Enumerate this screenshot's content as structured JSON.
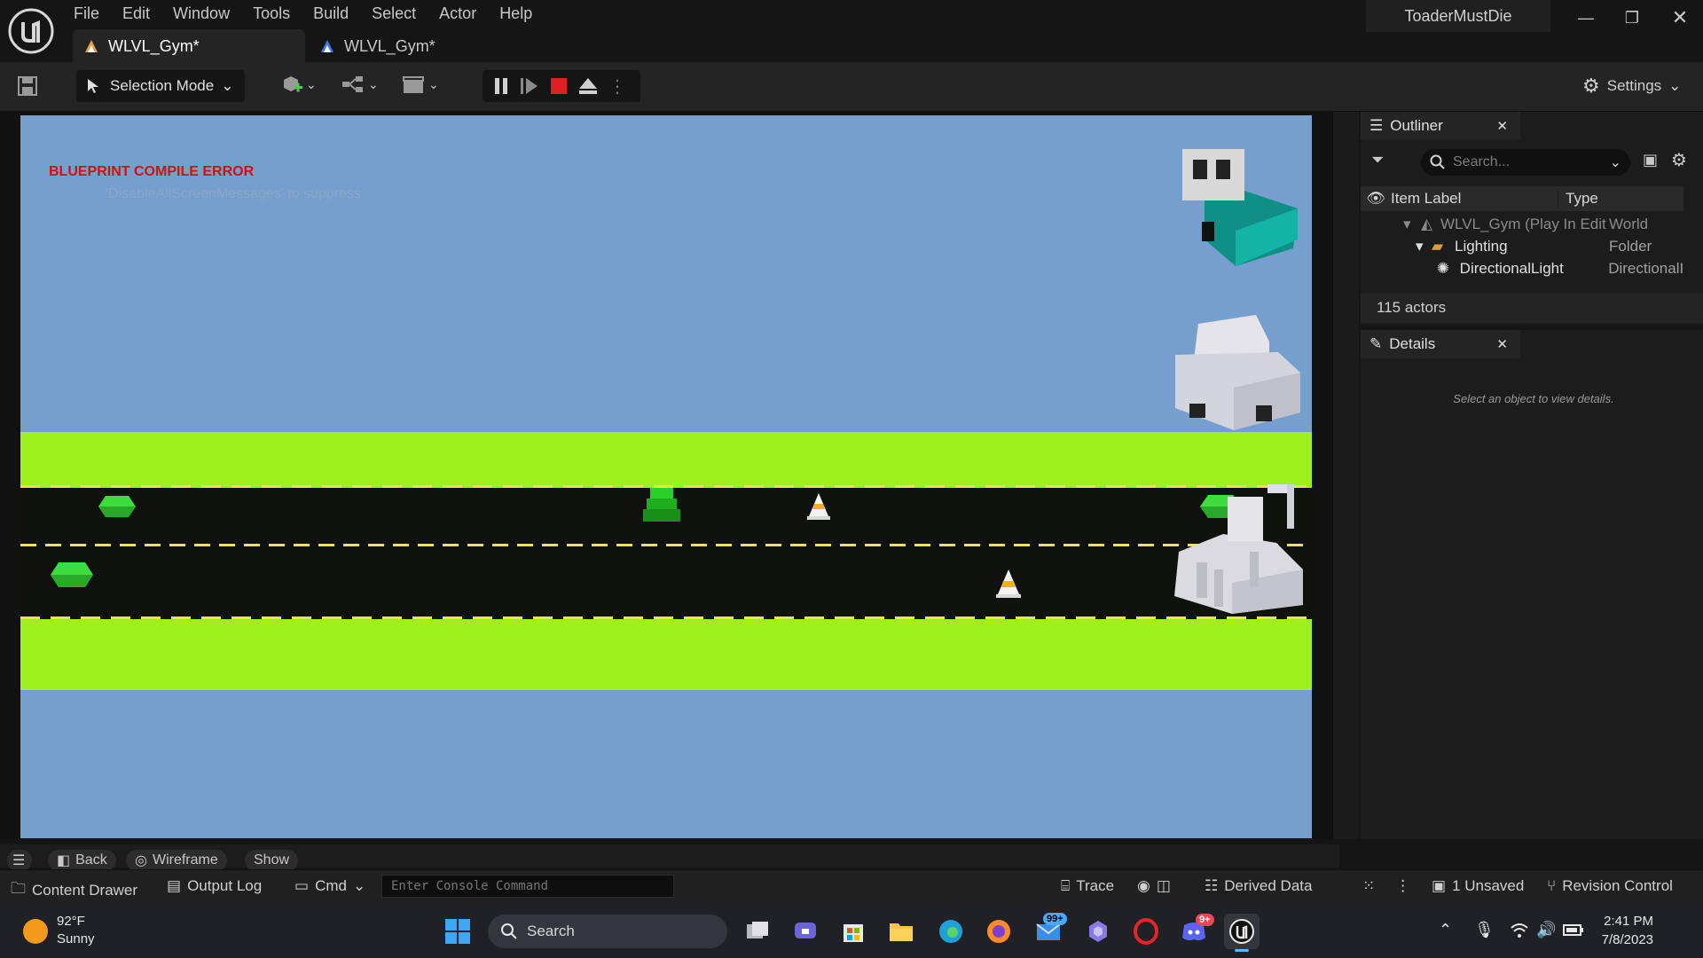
{
  "titlebar": {
    "menu": [
      "File",
      "Edit",
      "Window",
      "Tools",
      "Build",
      "Select",
      "Actor",
      "Help"
    ],
    "tabs": [
      {
        "label": "WLVL_Gym*"
      },
      {
        "label": "WLVL_Gym*"
      }
    ],
    "project_name": "ToaderMustDie"
  },
  "toolbar": {
    "selection_mode": "Selection Mode",
    "settings_label": "Settings"
  },
  "viewport": {
    "error_title": "BLUEPRINT COMPILE ERROR",
    "error_hint": "'DisableAllScreenMessages' to suppress",
    "bottom": {
      "back": "Back",
      "wireframe": "Wireframe",
      "show": "Show"
    }
  },
  "outliner": {
    "title": "Outliner",
    "search_placeholder": "Search...",
    "columns": {
      "label": "Item Label",
      "type": "Type"
    },
    "rows": [
      {
        "label": "WLVL_Gym (Play In Edit",
        "type": "World"
      },
      {
        "label": "Lighting",
        "type": "Folder"
      },
      {
        "label": "DirectionalLight",
        "type": "DirectionalI"
      }
    ],
    "actor_count": "115 actors"
  },
  "details": {
    "title": "Details",
    "empty_hint": "Select an object to view details."
  },
  "statusbar": {
    "content_drawer": "Content Drawer",
    "output_log": "Output Log",
    "cmd": "Cmd",
    "console_placeholder": "Enter Console Command",
    "trace": "Trace",
    "derived_data": "Derived Data",
    "unsaved": "1 Unsaved",
    "revision_control": "Revision Control"
  },
  "taskbar": {
    "weather_temp": "92°F",
    "weather_desc": "Sunny",
    "search_label": "Search",
    "mail_badge": "99+",
    "discord_badge": "9+",
    "time": "2:41 PM",
    "date": "7/8/2023"
  },
  "colors": {
    "sky": "#769fcd",
    "grass": "#9ef01e",
    "road": "#0e110c",
    "lane_marking": "#f1e14a",
    "error_text": "#d11111"
  }
}
